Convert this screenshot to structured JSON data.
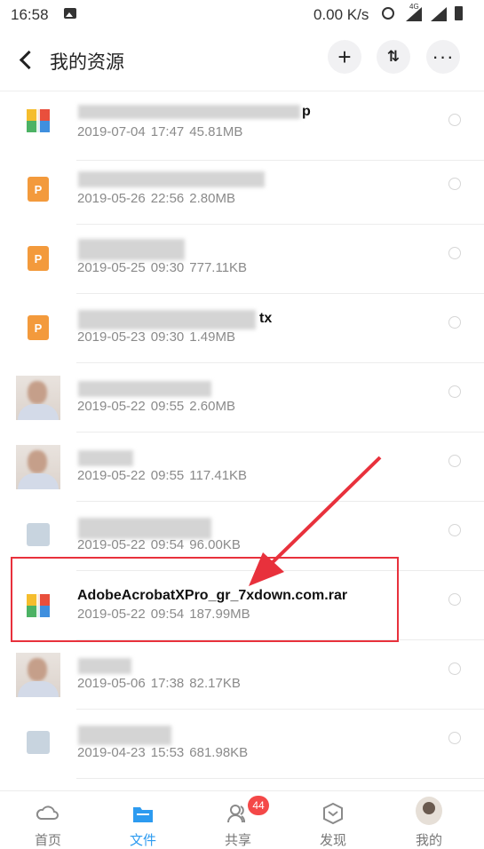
{
  "status_bar": {
    "time": "16:58",
    "network_speed": "0.00 K/s",
    "network_type": "4G"
  },
  "header": {
    "title": "我的资源",
    "add_symbol": "+",
    "sort_symbol": "⇅",
    "more_symbol": "···"
  },
  "files": [
    {
      "name": "",
      "date": "2019-07-04",
      "time": "17:47",
      "size": "45.81MB",
      "icon": "rar-archive-icon"
    },
    {
      "name": "",
      "date": "2019-05-26",
      "time": "22:56",
      "size": "2.80MB",
      "icon": "ppt-file-icon"
    },
    {
      "name": "",
      "date": "2019-05-25",
      "time": "09:30",
      "size": "777.11KB",
      "icon": "ppt-file-icon"
    },
    {
      "name": "",
      "date": "2019-05-23",
      "time": "09:30",
      "size": "1.49MB",
      "icon": "ppt-file-icon"
    },
    {
      "name": "",
      "date": "2019-05-22",
      "time": "09:55",
      "size": "2.60MB",
      "icon": "photo-thumbnail-icon"
    },
    {
      "name": "",
      "date": "2019-05-22",
      "time": "09:55",
      "size": "117.41KB",
      "icon": "photo-thumbnail-icon"
    },
    {
      "name": "",
      "date": "2019-05-22",
      "time": "09:54",
      "size": "96.00KB",
      "icon": "image-file-icon"
    },
    {
      "name": "AdobeAcrobatXPro_gr_7xdown.com.rar",
      "date": "2019-05-22",
      "time": "09:54",
      "size": "187.99MB",
      "icon": "rar-archive-icon"
    },
    {
      "name": "",
      "date": "2019-05-06",
      "time": "17:38",
      "size": "82.17KB",
      "icon": "photo-thumbnail-icon"
    },
    {
      "name": "",
      "date": "2019-04-23",
      "time": "15:53",
      "size": "681.98KB",
      "icon": "image-file-icon"
    }
  ],
  "name_fragments": {
    "row1_tail": "p",
    "row4_tail": "tx",
    "ppt_letter": "P"
  },
  "tabs": [
    {
      "label": "首页",
      "icon": "home-cloud-icon"
    },
    {
      "label": "文件",
      "icon": "folder-icon",
      "active": true
    },
    {
      "label": "共享",
      "icon": "share-people-icon",
      "badge": "44"
    },
    {
      "label": "发现",
      "icon": "discover-box-icon"
    },
    {
      "label": "我的",
      "icon": "avatar-icon"
    }
  ],
  "colors": {
    "accent": "#2d9bf0",
    "highlight": "#e8313c",
    "badge": "#f44848",
    "ppt": "#f39a3c"
  }
}
